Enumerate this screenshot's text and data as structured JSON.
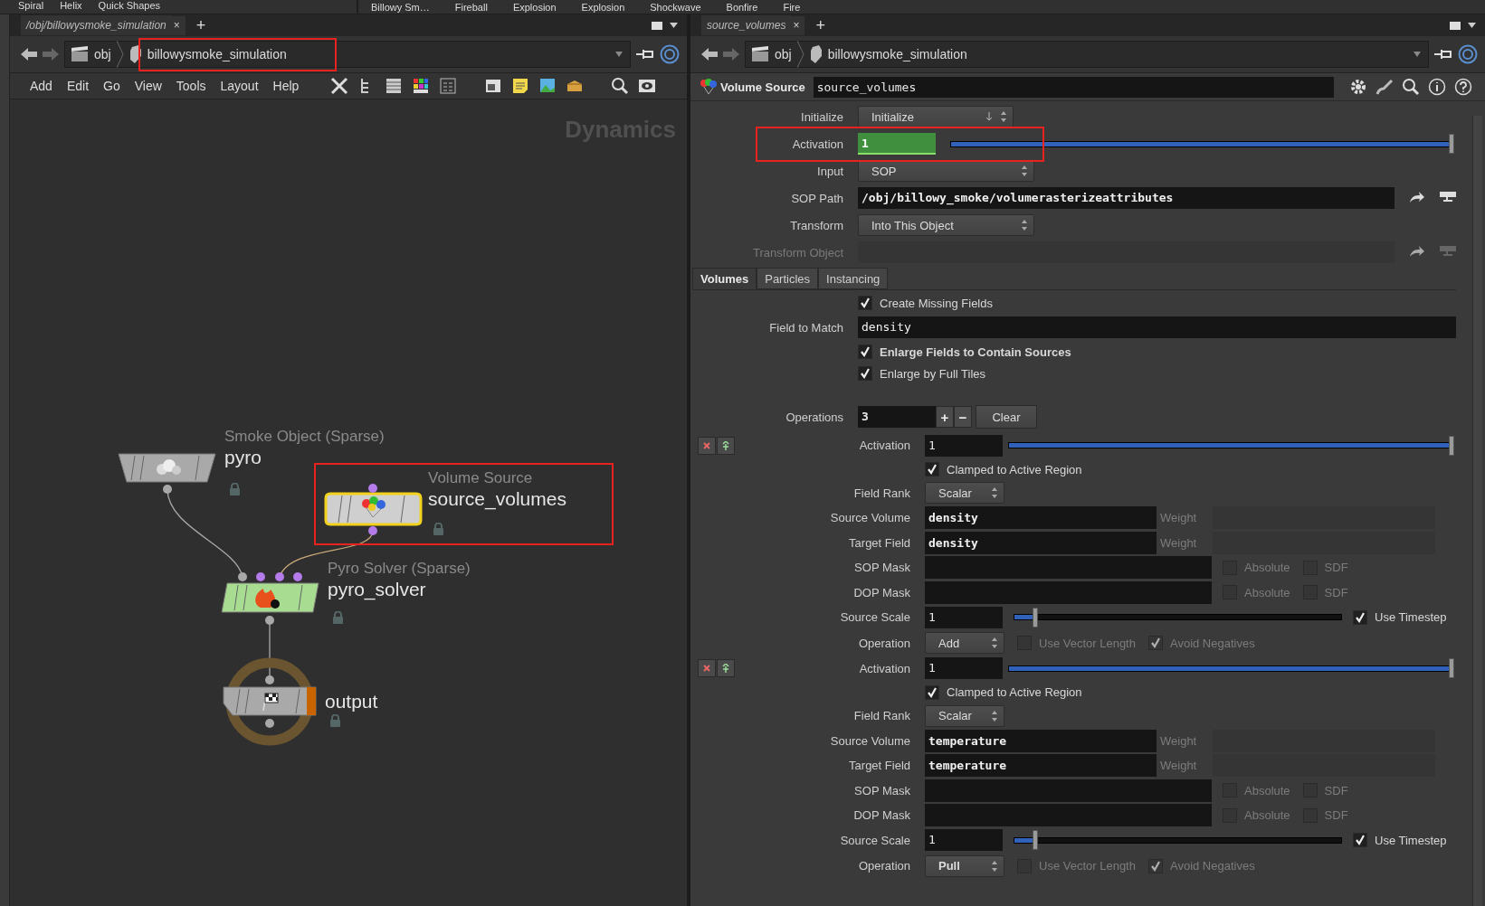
{
  "shelf": {
    "left_tools": [
      "Spiral",
      "Helix",
      "Quick Shapes"
    ],
    "right_tools": [
      "Billowy Sm…",
      "Fireball",
      "Explosion",
      "Explosion",
      "Shockwave",
      "Bonfire",
      "Fire"
    ]
  },
  "network_pane": {
    "tab": "/obj/billowysmoke_simulation",
    "close": "×",
    "new_tab": "+",
    "path": [
      "obj",
      "billowysmoke_simulation"
    ],
    "menu": [
      "Add",
      "Edit",
      "Go",
      "View",
      "Tools",
      "Layout",
      "Help"
    ],
    "context": "Dynamics",
    "nodes": [
      {
        "kind": "smoke_object",
        "type": "Smoke Object (Sparse)",
        "name": "pyro",
        "selected": false
      },
      {
        "kind": "volume_source",
        "type": "Volume Source",
        "name": "source_volumes",
        "selected": true
      },
      {
        "kind": "solver",
        "type": "Pyro Solver (Sparse)",
        "name": "pyro_solver",
        "selected": false
      },
      {
        "kind": "output",
        "name": "output",
        "selected": false
      }
    ]
  },
  "parameter_pane": {
    "tab": "source_volumes",
    "close": "×",
    "new_tab": "+",
    "path": [
      "obj",
      "billowysmoke_simulation"
    ],
    "node_type": "Volume Source",
    "node_name": "source_volumes",
    "params": [
      {
        "kind": "menu",
        "label": "Initialize",
        "value": "Initialize"
      },
      {
        "kind": "slider",
        "label": "Activation",
        "value": "1",
        "level": 1,
        "expression": true
      },
      {
        "kind": "menu",
        "label": "Input",
        "value": "SOP"
      },
      {
        "kind": "path",
        "label": "SOP Path",
        "value": "/obj/billowy_smoke/volumerasterizeattributes",
        "disabled": false
      },
      {
        "kind": "menu",
        "label": "Transform",
        "value": "Into This Object"
      },
      {
        "kind": "path",
        "label": "Transform Object",
        "disabled": true
      }
    ],
    "tabs": [
      {
        "label": "Volumes",
        "selected": true
      },
      {
        "label": "Particles",
        "selected": false
      },
      {
        "label": "Instancing",
        "selected": false
      }
    ],
    "volume_params": [
      {
        "kind": "checkbox",
        "label": "Create Missing Fields",
        "checked": true,
        "modified": false
      },
      {
        "kind": "text",
        "label": "Field to Match",
        "value": "density"
      },
      {
        "kind": "checkbox",
        "label": "Enlarge Fields to Contain Sources",
        "checked": true,
        "modified": true
      },
      {
        "kind": "checkbox",
        "label": "Enlarge by Full Tiles",
        "checked": true,
        "modified": false
      }
    ],
    "operations": {
      "label": "Operations",
      "count": "3",
      "add": "+",
      "remove": "−",
      "clear": "Clear"
    },
    "blocks": [
      {
        "activation": {
          "label": "Activation",
          "value": "1",
          "level": 1
        },
        "clamped": {
          "label": "Clamped to Active Region",
          "checked": true
        },
        "field_rank": {
          "label": "Field Rank",
          "value": "Scalar"
        },
        "source_volume": {
          "label": "Source Volume",
          "value": "density",
          "weight": "Weight"
        },
        "target_field": {
          "label": "Target Field",
          "value": "density",
          "weight": "Weight"
        },
        "sop_mask": {
          "label": "SOP Mask",
          "absolute": {
            "label": "Absolute",
            "checked": false
          },
          "sdf": {
            "label": "SDF",
            "checked": false
          }
        },
        "dop_mask": {
          "label": "DOP Mask",
          "absolute": {
            "label": "Absolute",
            "checked": false
          },
          "sdf": {
            "label": "SDF",
            "checked": false
          }
        },
        "source_scale": {
          "label": "Source Scale",
          "value": "1",
          "level": 0.06,
          "use_timestep": {
            "label": "Use Timestep",
            "checked": true
          }
        },
        "operation": {
          "label": "Operation",
          "value": "Add",
          "modified": false,
          "use_vector_length": {
            "label": "Use Vector Length",
            "checked": false
          },
          "avoid_negatives": {
            "label": "Avoid Negatives",
            "checked": true
          }
        }
      },
      {
        "activation": {
          "label": "Activation",
          "value": "1",
          "level": 1
        },
        "clamped": {
          "label": "Clamped to Active Region",
          "checked": true
        },
        "field_rank": {
          "label": "Field Rank",
          "value": "Scalar"
        },
        "source_volume": {
          "label": "Source Volume",
          "value": "temperature",
          "weight": "Weight"
        },
        "target_field": {
          "label": "Target Field",
          "value": "temperature",
          "weight": "Weight"
        },
        "sop_mask": {
          "label": "SOP Mask",
          "absolute": {
            "label": "Absolute",
            "checked": false
          },
          "sdf": {
            "label": "SDF",
            "checked": false
          }
        },
        "dop_mask": {
          "label": "DOP Mask",
          "absolute": {
            "label": "Absolute",
            "checked": false
          },
          "sdf": {
            "label": "SDF",
            "checked": false
          }
        },
        "source_scale": {
          "label": "Source Scale",
          "value": "1",
          "level": 0.06,
          "use_timestep": {
            "label": "Use Timestep",
            "checked": true
          }
        },
        "operation": {
          "label": "Operation",
          "value": "Pull",
          "modified": true,
          "use_vector_length": {
            "label": "Use Vector Length",
            "checked": false
          },
          "avoid_negatives": {
            "label": "Avoid Negatives",
            "checked": true
          }
        }
      }
    ]
  }
}
